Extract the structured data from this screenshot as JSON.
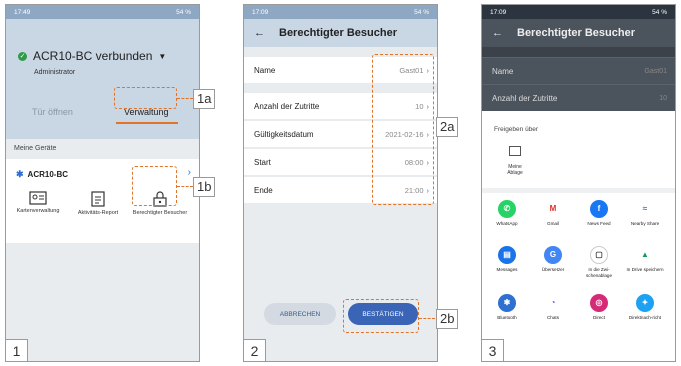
{
  "panel1": {
    "status_time": "17:49",
    "status_battery": "54 %",
    "connection": "ACR10-BC verbunden",
    "role": "Administrator",
    "tab_open": "Tür öffnen",
    "tab_manage": "Verwaltung",
    "section": "Meine Geräte",
    "device": "ACR10-BC",
    "features": [
      {
        "label": "Kartenverwaltung",
        "icon": "card-icon"
      },
      {
        "label": "Aktivitäts-Report",
        "icon": "report-icon"
      },
      {
        "label": "Berechtigter Besucher",
        "icon": "visitor-icon"
      }
    ],
    "number": "1"
  },
  "panel2": {
    "status_time": "17:09",
    "status_battery": "54 %",
    "title": "Berechtigter Besucher",
    "rows": [
      {
        "label": "Name",
        "value": "Gast01"
      },
      {
        "label": "Anzahl der Zutritte",
        "value": "10"
      },
      {
        "label": "Gültigkeitsdatum",
        "value": "2021-02-16"
      },
      {
        "label": "Start",
        "value": "08:00"
      },
      {
        "label": "Ende",
        "value": "21:00"
      }
    ],
    "cancel": "ABBRECHEN",
    "confirm": "BESTÄTIGEN",
    "number": "2"
  },
  "panel3": {
    "status_time": "17:09",
    "status_battery": "54 %",
    "title": "Berechtigter Besucher",
    "rows": [
      {
        "label": "Name",
        "value": "Gast01"
      },
      {
        "label": "Anzahl der Zutritte",
        "value": "10"
      }
    ],
    "share_title": "Freigeben über",
    "storage": "Meine Ablage",
    "apps": [
      {
        "label": "WhatsApp",
        "color": "#25d366",
        "glyph": "✆"
      },
      {
        "label": "Gmail",
        "color": "#ffffff",
        "glyph": "M"
      },
      {
        "label": "News Feed",
        "color": "#1877f2",
        "glyph": "f"
      },
      {
        "label": "Nearby Share",
        "color": "#ffffff",
        "glyph": "≈"
      },
      {
        "label": "Messages",
        "color": "#1a73e8",
        "glyph": "▤"
      },
      {
        "label": "Übersetzer",
        "color": "#4285f4",
        "glyph": "G"
      },
      {
        "label": "In die Zwi-schenablage",
        "color": "#ffffff",
        "glyph": "▢"
      },
      {
        "label": "In Drive speichern",
        "color": "#ffffff",
        "glyph": "▲"
      },
      {
        "label": "Bluetooth",
        "color": "#2f6fd1",
        "glyph": "✱"
      },
      {
        "label": "Chats",
        "color": "#ffffff",
        "glyph": "◔"
      },
      {
        "label": "Direct",
        "color": "#d62976",
        "glyph": "◎"
      },
      {
        "label": "Direktnach-richt",
        "color": "#1da1f2",
        "glyph": "✦"
      }
    ],
    "number": "3"
  },
  "callouts": {
    "c1a": "1a",
    "c1b": "1b",
    "c2a": "2a",
    "c2b": "2b"
  }
}
